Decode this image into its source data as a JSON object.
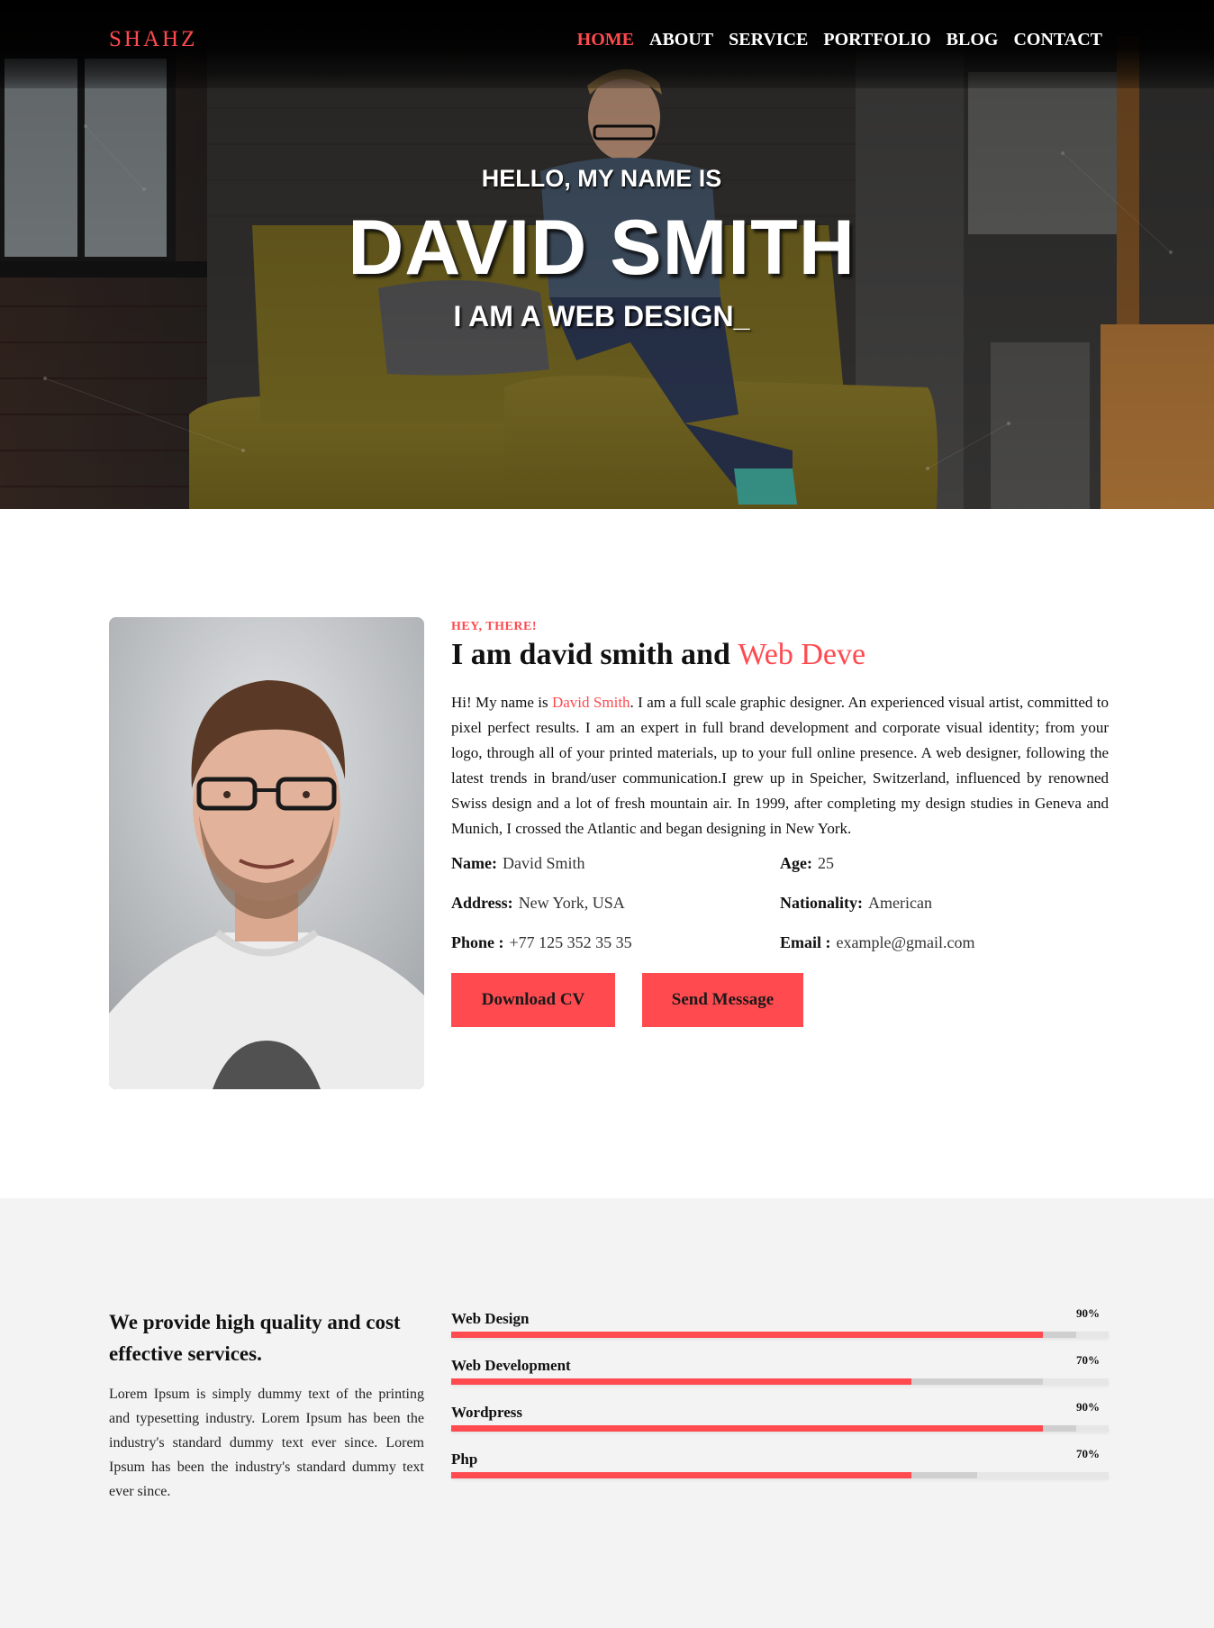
{
  "brand": {
    "logo": "SHAHZ",
    "accent_color": "#ff4a4f"
  },
  "nav": {
    "items": [
      {
        "label": "HOME",
        "active": true
      },
      {
        "label": "ABOUT",
        "active": false
      },
      {
        "label": "SERVICE",
        "active": false
      },
      {
        "label": "PORTFOLIO",
        "active": false
      },
      {
        "label": "BLOG",
        "active": false
      },
      {
        "label": "CONTACT",
        "active": false
      }
    ]
  },
  "hero": {
    "greeting": "HELLO, MY NAME IS",
    "name": "DAVID SMITH",
    "role": "I AM A WEB DESIGN_"
  },
  "about": {
    "kicker": "HEY, THERE!",
    "heading_main": "I am david smith and ",
    "heading_accent": "Web Deve",
    "bio_before": "Hi! My name is ",
    "bio_name": "David Smith",
    "bio_after": ". I am a full scale graphic designer. An experienced visual artist, committed to pixel perfect results. I am an expert in full brand development and corporate visual identity; from your logo, through all of your printed materials, up to your full online presence. A web designer, following the latest trends in brand/user communication.I grew up in Speicher, Switzerland, influenced by renowned Swiss design and a lot of fresh mountain air. In 1999, after completing my design studies in Geneva and Munich, I crossed the Atlantic and began designing in New York.",
    "info": {
      "name_label": "Name:",
      "name_value": "David Smith",
      "age_label": "Age:",
      "age_value": "25",
      "address_label": "Address:",
      "address_value": "New York, USA",
      "nationality_label": "Nationality:",
      "nationality_value": "American",
      "phone_label": "Phone :",
      "phone_value": "+77 125 352 35 35",
      "email_label": "Email :",
      "email_value": "example@gmail.com"
    },
    "buttons": {
      "download": "Download CV",
      "message": "Send Message"
    }
  },
  "services": {
    "heading": "We provide high quality and cost effective services.",
    "body": "Lorem Ipsum is simply dummy text of the printing and typesetting industry. Lorem Ipsum has been the industry's standard dummy text ever since. Lorem Ipsum has been the industry's standard dummy text ever since."
  },
  "skills": [
    {
      "name": "Web Design",
      "percent_label": "90%",
      "percent": 90,
      "ghost_percent": 95
    },
    {
      "name": "Web Development",
      "percent_label": "70%",
      "percent": 70,
      "ghost_percent": 90
    },
    {
      "name": "Wordpress",
      "percent_label": "90%",
      "percent": 90,
      "ghost_percent": 95
    },
    {
      "name": "Php",
      "percent_label": "70%",
      "percent": 70,
      "ghost_percent": 80
    }
  ]
}
